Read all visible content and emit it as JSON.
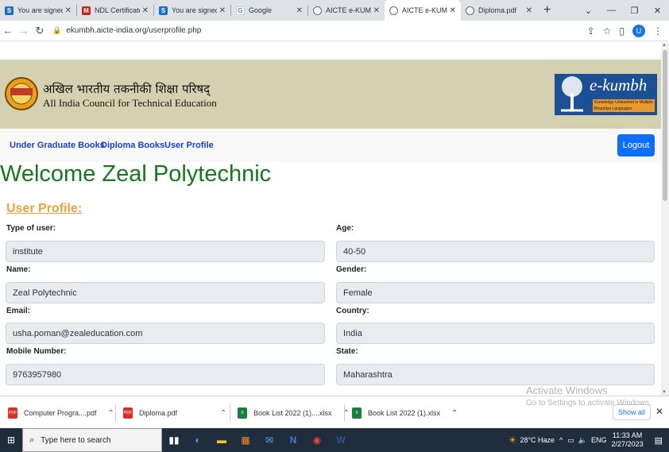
{
  "browser": {
    "tabs": [
      {
        "label": "You are signed in",
        "favicon": "S",
        "color": "#1e6fc9",
        "active": false
      },
      {
        "label": "NDL Certificate -",
        "favicon": "M",
        "color": "#c5221f",
        "active": false
      },
      {
        "label": "You are signed in",
        "favicon": "S",
        "color": "#1e6fc9",
        "active": false
      },
      {
        "label": "Google",
        "favicon": "G",
        "color": "#4285f4",
        "active": false
      },
      {
        "label": "AICTE e-KUMBH",
        "favicon": "globe",
        "color": "#555555",
        "active": false
      },
      {
        "label": "AICTE e-KUMBH",
        "favicon": "globe",
        "color": "#555555",
        "active": true
      },
      {
        "label": "Diploma.pdf",
        "favicon": "globe",
        "color": "#555555",
        "active": false
      }
    ],
    "new_tab": "+",
    "url": "ekumbh.aicte-india.org/userprofile.php",
    "profile_initial": "U"
  },
  "banner": {
    "hindi_name": "अखिल भारतीय तकनीकी शिक्षा परिषद्",
    "english_name": "All India Council for Technical Education",
    "logo_text": "AICTE",
    "ekumbh_title": "e-kumbh",
    "ekumbh_tagline": "Knowledge Unleashed in Multiple Bharatiya Languages"
  },
  "nav": {
    "links": [
      "Under Graduate Books",
      "Diploma Books",
      "User Profile"
    ],
    "logout": "Logout"
  },
  "welcome": "Welcome Zeal Polytechnic",
  "profile_heading": "User Profile:",
  "fields": {
    "type_of_user": {
      "label": "Type of user:",
      "value": "institute"
    },
    "age": {
      "label": "Age:",
      "value": "40-50"
    },
    "name": {
      "label": "Name:",
      "value": "Zeal Polytechnic"
    },
    "gender": {
      "label": "Gender:",
      "value": "Female"
    },
    "email": {
      "label": "Email:",
      "value": "usha.poman@zealeducation.com"
    },
    "country": {
      "label": "Country:",
      "value": "India"
    },
    "mobile": {
      "label": "Mobile Number:",
      "value": "9763957980"
    },
    "state": {
      "label": "State:",
      "value": "Maharashtra"
    }
  },
  "watermark": {
    "title": "Activate Windows",
    "subtitle": "Go to Settings to activate Windows."
  },
  "downloads": {
    "items": [
      {
        "name": "Computer Progra....pdf",
        "type": "pdf"
      },
      {
        "name": "Diploma.pdf",
        "type": "pdf"
      },
      {
        "name": "Book List  2022 (1)....xlsx",
        "type": "xlsx"
      },
      {
        "name": "Book List  2022 (1).xlsx",
        "type": "xlsx"
      }
    ],
    "show_all": "Show all"
  },
  "taskbar": {
    "search_placeholder": "Type here to search",
    "weather": "28°C  Haze",
    "language": "ENG",
    "time": "11:33 AM",
    "date": "2/27/2023"
  }
}
